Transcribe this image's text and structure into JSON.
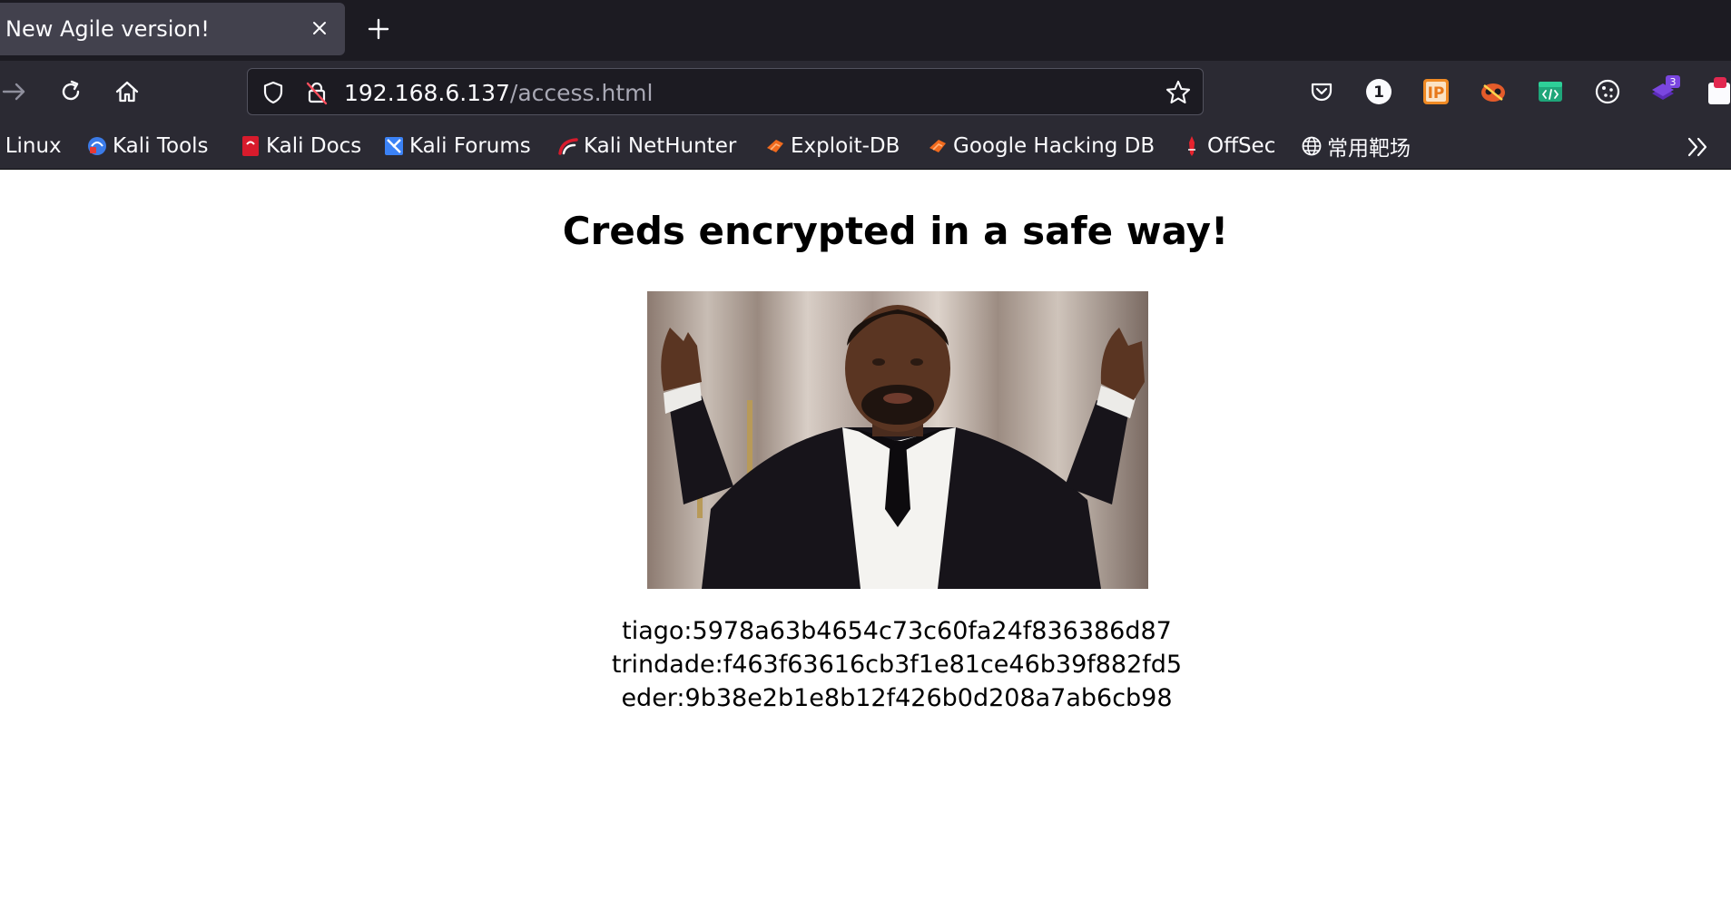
{
  "browser": {
    "tab": {
      "title": "New Agile version!"
    },
    "address_bar": {
      "host": "192.168.6.137",
      "path": "/access.html"
    },
    "extensions": [
      {
        "icon": "password-manager-icon",
        "label": "1"
      },
      {
        "icon": "ip-extension-icon",
        "label": "IP"
      },
      {
        "icon": "hack-tools-icon"
      },
      {
        "icon": "code-extension-icon"
      },
      {
        "icon": "cookie-icon"
      },
      {
        "icon": "stack-extension-icon",
        "badge": "3"
      },
      {
        "icon": "extension-icon"
      }
    ],
    "bookmarks": [
      {
        "label": "i Linux",
        "icon": "kali-linux-icon"
      },
      {
        "label": "Kali Tools",
        "icon": "kali-tools-icon"
      },
      {
        "label": "Kali Docs",
        "icon": "kali-docs-icon"
      },
      {
        "label": "Kali Forums",
        "icon": "kali-forums-icon"
      },
      {
        "label": "Kali NetHunter",
        "icon": "kali-nethunter-icon"
      },
      {
        "label": "Exploit-DB",
        "icon": "exploit-db-icon"
      },
      {
        "label": "Google Hacking DB",
        "icon": "google-hacking-db-icon"
      },
      {
        "label": "OffSec",
        "icon": "offsec-icon"
      },
      {
        "label": "常用靶场",
        "icon": "globe-icon"
      }
    ]
  },
  "page": {
    "heading": "Creds encrypted in a safe way!",
    "credentials": [
      "tiago:5978a63b4654c73c60fa24f836386d87",
      "trindade:f463f63616cb3f1e81ce46b39f882fd5",
      "eder:9b38e2b1e8b12f426b0d208a7ab6cb98"
    ]
  },
  "colors": {
    "tab_strip": "#1c1b22",
    "toolbar": "#2b2a33",
    "active_tab": "#42414d",
    "page_background": "#ffffff"
  }
}
